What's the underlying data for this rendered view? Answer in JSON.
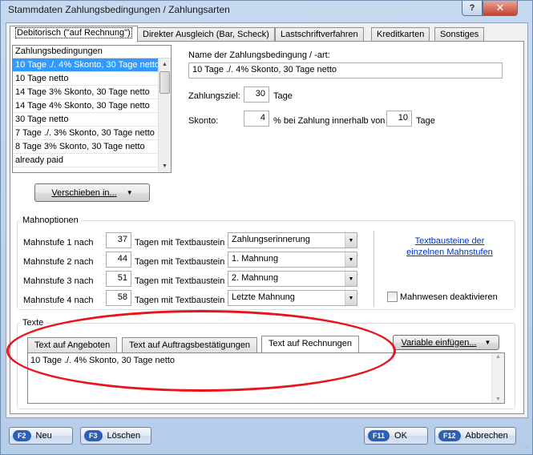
{
  "window": {
    "title": "Stammdaten Zahlungsbedingungen / Zahlungsarten",
    "help_label": "?",
    "close_label": "✕"
  },
  "tabs": [
    {
      "label": "Debitorisch (\"auf Rechnung\")",
      "active": true
    },
    {
      "label": "Direkter Ausgleich (Bar, Scheck)"
    },
    {
      "label": "Lastschriftverfahren"
    },
    {
      "label": "Kreditkarten"
    },
    {
      "label": "Sonstiges"
    }
  ],
  "payment_terms": {
    "header": "Zahlungsbedingungen",
    "items": [
      "10 Tage ./. 4% Skonto, 30 Tage netto",
      "10 Tage netto",
      "14 Tage 3% Skonto, 30 Tage netto",
      "14 Tage 4% Skonto, 30 Tage netto",
      "30 Tage netto",
      "7 Tage ./. 3% Skonto, 30 Tage netto",
      "8 Tage 3% Skonto, 30 Tage netto",
      "already paid"
    ],
    "selected_index": 0
  },
  "move_button": {
    "label": "Verschieben in...",
    "arrow": "▼"
  },
  "detail": {
    "name_label": "Name der Zahlungsbedingung / -art:",
    "name_value": "10 Tage ./. 4% Skonto, 30 Tage netto",
    "ziel_label": "Zahlungsziel:",
    "ziel_value": "30",
    "ziel_unit": "Tage",
    "skonto_label": "Skonto:",
    "skonto_value": "4",
    "skonto_mid": "% bei Zahlung innerhalb von",
    "skonto_days": "10",
    "skonto_unit": "Tage"
  },
  "dunning": {
    "title": "Mahnoptionen",
    "mid_text": "Tagen mit Textbaustein",
    "rows": [
      {
        "label": "Mahnstufe 1 nach",
        "days": "37",
        "template": "Zahlungserinnerung"
      },
      {
        "label": "Mahnstufe 2 nach",
        "days": "44",
        "template": "1. Mahnung"
      },
      {
        "label": "Mahnstufe 3 nach",
        "days": "51",
        "template": "2. Mahnung"
      },
      {
        "label": "Mahnstufe 4 nach",
        "days": "58",
        "template": "Letzte Mahnung"
      }
    ],
    "link_line1": "Textbausteine der",
    "link_line2": "einzelnen Mahnstufen",
    "deactivate_label": "Mahnwesen deaktivieren",
    "deactivate_checked": false
  },
  "texts": {
    "title": "Texte",
    "tabs": [
      {
        "label": "Text auf Angeboten"
      },
      {
        "label": "Text auf Auftragsbestätigungen"
      },
      {
        "label": "Text auf Rechnungen",
        "active": true
      }
    ],
    "variable_button": "Variable einfügen...",
    "content": "10 Tage ./. 4% Skonto, 30 Tage netto"
  },
  "footer": {
    "new": {
      "key": "F2",
      "label": "Neu"
    },
    "delete": {
      "key": "F3",
      "label": "Löschen"
    },
    "ok": {
      "key": "F11",
      "label": "OK"
    },
    "cancel": {
      "key": "F12",
      "label": "Abbrechen"
    }
  },
  "colors": {
    "selection": "#3399ff",
    "annotation_ellipse": "#e8141c",
    "link": "#0033cc",
    "fkey_badge": "#2f5fb3"
  }
}
